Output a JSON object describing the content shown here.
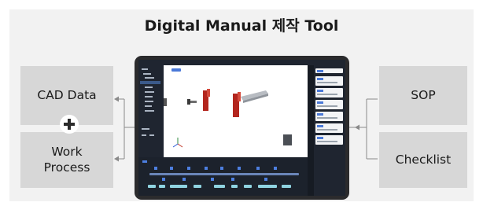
{
  "title": "Digital Manual 제작 Tool",
  "inputs": [
    {
      "label": "CAD Data"
    },
    {
      "label": "Work\nProcess"
    }
  ],
  "outputs": [
    {
      "label": "SOP"
    },
    {
      "label": "Checklist"
    }
  ],
  "icons": {
    "plus": "plus-icon",
    "arrow": "arrow-left-icon"
  },
  "colors": {
    "box": "#d7d7d7",
    "frame": "#f2f2f2",
    "tablet": "#2b2b2d",
    "screen_dark": "#1f2530",
    "accent": "#4a79d8",
    "part_red": "#b3261e"
  }
}
